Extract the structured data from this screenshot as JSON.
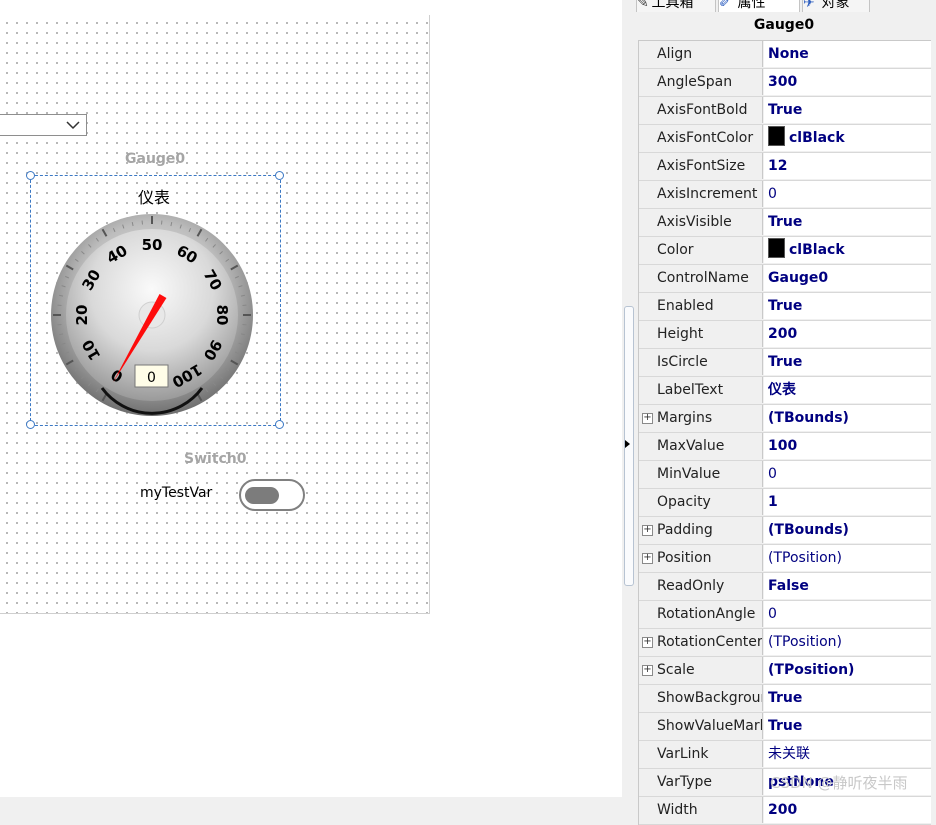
{
  "inspector": {
    "tabs": [
      "工具箱",
      "属性",
      "对象"
    ],
    "object_title": "Gauge0",
    "properties": [
      {
        "key": "Align",
        "value": "None",
        "bold": true
      },
      {
        "key": "AngleSpan",
        "value": "300",
        "bold": true
      },
      {
        "key": "AxisFontBold",
        "value": "True",
        "bold": true
      },
      {
        "key": "AxisFontColor",
        "value": "clBlack",
        "bold": true,
        "swatch": "#000000"
      },
      {
        "key": "AxisFontSize",
        "value": "12",
        "bold": true
      },
      {
        "key": "AxisIncrement",
        "value": "0",
        "bold": false
      },
      {
        "key": "AxisVisible",
        "value": "True",
        "bold": true
      },
      {
        "key": "Color",
        "value": "clBlack",
        "bold": true,
        "swatch": "#000000"
      },
      {
        "key": "ControlName",
        "value": "Gauge0",
        "bold": true
      },
      {
        "key": "Enabled",
        "value": "True",
        "bold": true
      },
      {
        "key": "Height",
        "value": "200",
        "bold": true
      },
      {
        "key": "IsCircle",
        "value": "True",
        "bold": true
      },
      {
        "key": "LabelText",
        "value": "仪表",
        "bold": true
      },
      {
        "key": "Margins",
        "value": "(TBounds)",
        "bold": true,
        "expandable": true
      },
      {
        "key": "MaxValue",
        "value": "100",
        "bold": true
      },
      {
        "key": "MinValue",
        "value": "0",
        "bold": false
      },
      {
        "key": "Opacity",
        "value": "1",
        "bold": true
      },
      {
        "key": "Padding",
        "value": "(TBounds)",
        "bold": true,
        "expandable": true
      },
      {
        "key": "Position",
        "value": "(TPosition)",
        "bold": false,
        "expandable": true
      },
      {
        "key": "ReadOnly",
        "value": "False",
        "bold": true
      },
      {
        "key": "RotationAngle",
        "value": "0",
        "bold": false
      },
      {
        "key": "RotationCenter",
        "value": "(TPosition)",
        "bold": false,
        "expandable": true
      },
      {
        "key": "Scale",
        "value": "(TPosition)",
        "bold": true,
        "expandable": true
      },
      {
        "key": "ShowBackgrour",
        "value": "True",
        "bold": true
      },
      {
        "key": "ShowValueMark",
        "value": "True",
        "bold": true
      },
      {
        "key": "VarLink",
        "value": "未关联",
        "bold": false
      },
      {
        "key": "VarType",
        "value": "pstNone",
        "bold": true
      },
      {
        "key": "Width",
        "value": "200",
        "bold": true
      }
    ]
  },
  "designer": {
    "gauge": {
      "name": "Gauge0",
      "label": "仪表",
      "value_box": "0",
      "value": 0,
      "min": 0,
      "max": 100,
      "angle_span": 300,
      "tick_labels": [
        "0",
        "10",
        "20",
        "30",
        "40",
        "50",
        "60",
        "70",
        "80",
        "90",
        "100"
      ]
    },
    "switch": {
      "name": "Switch0",
      "label": "myTestVar",
      "state": "off"
    }
  },
  "watermark": "CSDN @静听夜半雨",
  "colors": {
    "selection": "#3b78c4",
    "needle": "#ff0000",
    "value_text": "#000080"
  }
}
